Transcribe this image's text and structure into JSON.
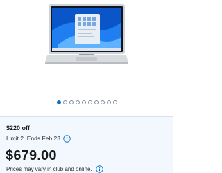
{
  "product": {
    "image_alt": "laptop-product-image",
    "carousel": {
      "total": 10,
      "active_index": 0
    }
  },
  "offer": {
    "discount_label": "$220 off",
    "limit_text": "Limit 2. Ends Feb 23"
  },
  "pricing": {
    "price": "$679.00",
    "note": "Prices may vary in club and online."
  },
  "colors": {
    "accent": "#0071ce",
    "panel_bg": "#f2f8fd"
  },
  "icons": {
    "limit_info": "info-icon",
    "note_info": "info-icon"
  }
}
